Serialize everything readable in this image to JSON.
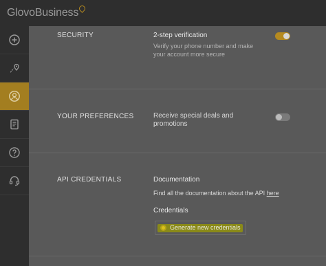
{
  "app": {
    "brand": "GlovoBusiness"
  },
  "sidebar": {
    "items": [
      {
        "name": "add",
        "icon": "plus-circle-icon"
      },
      {
        "name": "locations",
        "icon": "map-pin-icon"
      },
      {
        "name": "profile",
        "icon": "user-icon",
        "active": true
      },
      {
        "name": "orders",
        "icon": "document-icon"
      },
      {
        "name": "help",
        "icon": "help-icon"
      },
      {
        "name": "support",
        "icon": "headset-icon"
      }
    ]
  },
  "security": {
    "section_title": "SECURITY",
    "item_title": "2-step verification",
    "item_desc": "Verify your phone number and make your account more secure",
    "toggle_on": true
  },
  "preferences": {
    "section_title": "YOUR PREFERENCES",
    "item_desc": "Receive special deals and promotions",
    "toggle_on": false
  },
  "api": {
    "section_title": "API CREDENTIALS",
    "doc_title": "Documentation",
    "doc_text": "Find all the documentation about the API",
    "doc_link": "here",
    "cred_title": "Credentials",
    "generate_label": "Generate new credentials"
  },
  "colors": {
    "accent": "#b58a1f",
    "highlight": "#d8c21a"
  }
}
